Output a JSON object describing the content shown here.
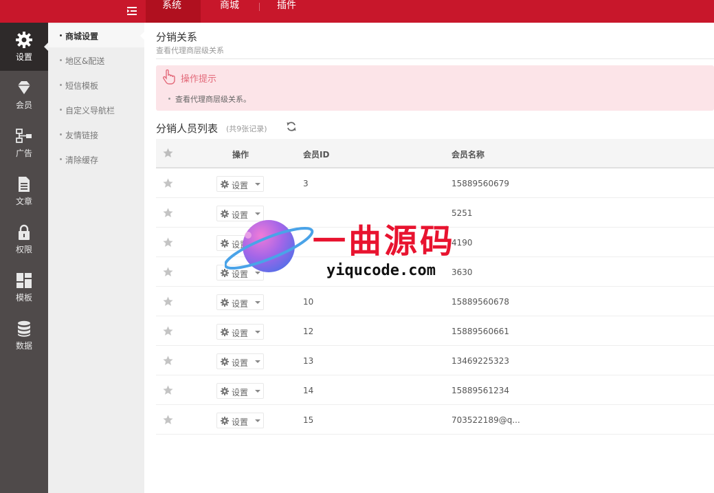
{
  "topnav": {
    "tabs": [
      {
        "label": "系统"
      },
      {
        "label": "商城"
      },
      {
        "label": "插件"
      }
    ]
  },
  "sidebar": {
    "items": [
      {
        "label": "设置",
        "icon": "gear-icon"
      },
      {
        "label": "会员",
        "icon": "diamond-icon"
      },
      {
        "label": "广告",
        "icon": "sitemap-icon"
      },
      {
        "label": "文章",
        "icon": "document-icon"
      },
      {
        "label": "权限",
        "icon": "lock-icon"
      },
      {
        "label": "模板",
        "icon": "grid-icon"
      },
      {
        "label": "数据",
        "icon": "database-icon"
      }
    ]
  },
  "subnav": {
    "items": [
      {
        "label": "商城设置"
      },
      {
        "label": "地区&配送"
      },
      {
        "label": "短信模板"
      },
      {
        "label": "自定义导航栏"
      },
      {
        "label": "友情链接"
      },
      {
        "label": "清除缓存"
      }
    ]
  },
  "page": {
    "title": "分销关系",
    "subtitle": "查看代理商层级关系"
  },
  "tips": {
    "title": "操作提示",
    "text": "查看代理商层级关系。"
  },
  "list": {
    "title": "分销人员列表",
    "count": "(共9张记录)"
  },
  "table": {
    "headers": {
      "action": "操作",
      "member_id": "会员ID",
      "member_name": "会员名称"
    },
    "action_label": "设置",
    "rows": [
      {
        "id": "3",
        "name": "15889560679"
      },
      {
        "id": "",
        "name": "5251"
      },
      {
        "id": "",
        "name": "4190"
      },
      {
        "id": "",
        "name": "3630"
      },
      {
        "id": "10",
        "name": "15889560678"
      },
      {
        "id": "12",
        "name": "15889560661"
      },
      {
        "id": "13",
        "name": "13469225323"
      },
      {
        "id": "14",
        "name": "15889561234"
      },
      {
        "id": "15",
        "name": "703522189@q..."
      }
    ]
  },
  "watermark": {
    "text": "一曲源码",
    "url": "yiqucode.com"
  },
  "colors": {
    "brand": "#c8172b",
    "sidebar": "#4f4a4a",
    "tips_bg": "#fce4e8",
    "tips_title": "#e36a7a"
  }
}
